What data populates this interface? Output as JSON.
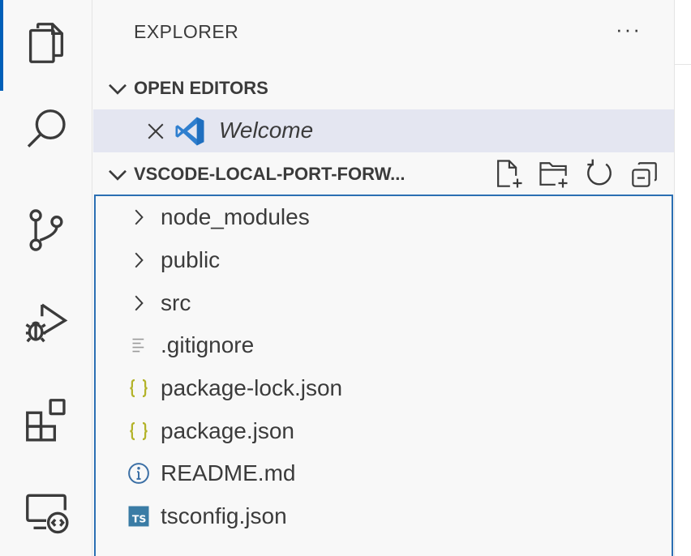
{
  "activity_bar": {
    "items": [
      {
        "name": "explorer",
        "icon": "files-icon",
        "active": true
      },
      {
        "name": "search",
        "icon": "search-icon",
        "active": false
      },
      {
        "name": "source-control",
        "icon": "source-control-icon",
        "active": false
      },
      {
        "name": "run-and-debug",
        "icon": "run-debug-icon",
        "active": false
      },
      {
        "name": "extensions",
        "icon": "extensions-icon",
        "active": false
      },
      {
        "name": "remote-explorer",
        "icon": "remote-explorer-icon",
        "active": false
      }
    ]
  },
  "sidebar": {
    "title": "EXPLORER",
    "more_actions": "···",
    "open_editors": {
      "label": "OPEN EDITORS",
      "items": [
        {
          "label": "Welcome",
          "icon": "vscode-logo-icon"
        }
      ]
    },
    "workspace": {
      "label": "VSCODE-LOCAL-PORT-FORW...",
      "actions": [
        "new-file-icon",
        "new-folder-icon",
        "refresh-icon",
        "collapse-all-icon"
      ],
      "tree": [
        {
          "label": "node_modules",
          "kind": "folder",
          "icon": "chevron-right-icon"
        },
        {
          "label": "public",
          "kind": "folder",
          "icon": "chevron-right-icon"
        },
        {
          "label": "src",
          "kind": "folder",
          "icon": "chevron-right-icon"
        },
        {
          "label": ".gitignore",
          "kind": "file",
          "icon": "text-file-icon"
        },
        {
          "label": "package-lock.json",
          "kind": "file",
          "icon": "json-icon"
        },
        {
          "label": "package.json",
          "kind": "file",
          "icon": "json-icon"
        },
        {
          "label": "README.md",
          "kind": "file",
          "icon": "info-icon"
        },
        {
          "label": "tsconfig.json",
          "kind": "file",
          "icon": "typescript-icon"
        }
      ]
    }
  },
  "colors": {
    "accent": "#005fb8",
    "selection": "#e4e6f1",
    "focus_border": "#2b6fb3",
    "json_icon": "#b3b32a",
    "ts_icon": "#3a7ca5",
    "info_icon": "#3b6fa5"
  }
}
